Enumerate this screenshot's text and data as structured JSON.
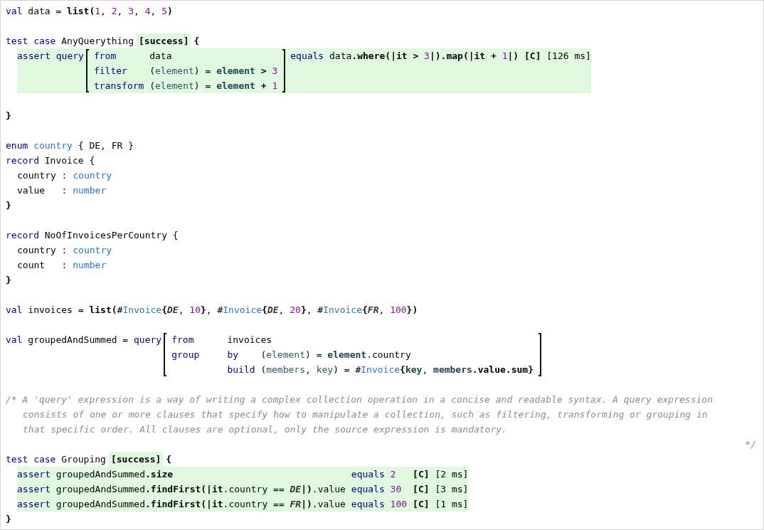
{
  "editor": {
    "blocks": [
      {
        "kind": "code",
        "tokens": [
          {
            "text": "val",
            "kind": "kw"
          },
          {
            "text": " data = ",
            "kind": "plain"
          },
          {
            "text": "list(",
            "kind": "bold"
          },
          {
            "text": "1",
            "kind": "num"
          },
          {
            "text": ", ",
            "kind": "plain"
          },
          {
            "text": "2",
            "kind": "num"
          },
          {
            "text": ", ",
            "kind": "plain"
          },
          {
            "text": "3",
            "kind": "num"
          },
          {
            "text": ", ",
            "kind": "plain"
          },
          {
            "text": "4",
            "kind": "num"
          },
          {
            "text": ", ",
            "kind": "plain"
          },
          {
            "text": "5",
            "kind": "num"
          },
          {
            "text": ")",
            "kind": "bold"
          }
        ]
      },
      {
        "kind": "blank"
      },
      {
        "kind": "test_header",
        "tokens": [
          {
            "text": "test case",
            "kind": "kw"
          },
          {
            "text": " AnyQuerything",
            "kind": "plain"
          }
        ],
        "status": "[success]",
        "passed": true,
        "after": [
          {
            "text": "{",
            "kind": "bold"
          }
        ]
      },
      {
        "kind": "query_assert",
        "passed": true,
        "prefix": [
          {
            "text": "assert query",
            "kind": "kw"
          }
        ],
        "clauses": [
          {
            "keyword": "from",
            "tokens": [
              {
                "text": "data",
                "kind": "plain"
              }
            ]
          },
          {
            "keyword": "filter",
            "tokens": [
              {
                "text": "(",
                "kind": "plain"
              },
              {
                "text": "element",
                "kind": "param"
              },
              {
                "text": ") = ",
                "kind": "plain"
              },
              {
                "text": "element",
                "kind": "paramb"
              },
              {
                "text": " > ",
                "kind": "bold"
              },
              {
                "text": "3",
                "kind": "num"
              }
            ]
          },
          {
            "keyword": "transform",
            "tokens": [
              {
                "text": "(",
                "kind": "plain"
              },
              {
                "text": "element",
                "kind": "param"
              },
              {
                "text": ") = ",
                "kind": "plain"
              },
              {
                "text": "element",
                "kind": "paramb"
              },
              {
                "text": " + ",
                "kind": "bold"
              },
              {
                "text": "1",
                "kind": "num"
              }
            ]
          }
        ],
        "suffix": [
          {
            "text": "equals",
            "kind": "kw"
          },
          {
            "text": " data",
            "kind": "plain"
          },
          {
            "text": ".where(|it > ",
            "kind": "bold"
          },
          {
            "text": "3",
            "kind": "num"
          },
          {
            "text": "|).map(|it + ",
            "kind": "bold"
          },
          {
            "text": "1",
            "kind": "num"
          },
          {
            "text": "|)",
            "kind": "bold"
          },
          {
            "text": " [C]",
            "kind": "bold"
          },
          {
            "text": " [126 ms]",
            "kind": "plain"
          }
        ]
      },
      {
        "kind": "blank"
      },
      {
        "kind": "code",
        "tokens": [
          {
            "text": "}",
            "kind": "bold"
          }
        ]
      },
      {
        "kind": "blank"
      },
      {
        "kind": "code",
        "tokens": [
          {
            "text": "enum",
            "kind": "kw"
          },
          {
            "text": " country",
            "kind": "type"
          },
          {
            "text": " { DE, FR }",
            "kind": "plain"
          }
        ]
      },
      {
        "kind": "code",
        "tokens": [
          {
            "text": "record",
            "kind": "kw"
          },
          {
            "text": " Invoice {",
            "kind": "plain"
          }
        ]
      },
      {
        "kind": "member",
        "tokens": [
          {
            "text": "country : ",
            "kind": "plain"
          },
          {
            "text": "country",
            "kind": "type"
          }
        ]
      },
      {
        "kind": "member",
        "tokens": [
          {
            "text": "value   : ",
            "kind": "plain"
          },
          {
            "text": "number",
            "kind": "type"
          }
        ]
      },
      {
        "kind": "code",
        "tokens": [
          {
            "text": "}",
            "kind": "bold"
          }
        ]
      },
      {
        "kind": "blank"
      },
      {
        "kind": "code",
        "tokens": [
          {
            "text": "record",
            "kind": "kw"
          },
          {
            "text": " NoOfInvoicesPerCountry {",
            "kind": "plain"
          }
        ]
      },
      {
        "kind": "member",
        "tokens": [
          {
            "text": "country : ",
            "kind": "plain"
          },
          {
            "text": "country",
            "kind": "type"
          }
        ]
      },
      {
        "kind": "member",
        "tokens": [
          {
            "text": "count   : ",
            "kind": "plain"
          },
          {
            "text": "number",
            "kind": "type"
          }
        ]
      },
      {
        "kind": "code",
        "tokens": [
          {
            "text": "}",
            "kind": "bold"
          }
        ]
      },
      {
        "kind": "blank"
      },
      {
        "kind": "code",
        "tokens": [
          {
            "text": "val",
            "kind": "kw"
          },
          {
            "text": " invoices = ",
            "kind": "plain"
          },
          {
            "text": "list(",
            "kind": "bold"
          },
          {
            "text": "#",
            "kind": "plain"
          },
          {
            "text": "Invoice",
            "kind": "type"
          },
          {
            "text": "{",
            "kind": "bold"
          },
          {
            "text": "DE",
            "kind": "lit"
          },
          {
            "text": ", ",
            "kind": "plain"
          },
          {
            "text": "10",
            "kind": "num"
          },
          {
            "text": "}",
            "kind": "bold"
          },
          {
            "text": ", #",
            "kind": "plain"
          },
          {
            "text": "Invoice",
            "kind": "type"
          },
          {
            "text": "{",
            "kind": "bold"
          },
          {
            "text": "DE",
            "kind": "lit"
          },
          {
            "text": ", ",
            "kind": "plain"
          },
          {
            "text": "20",
            "kind": "num"
          },
          {
            "text": "}",
            "kind": "bold"
          },
          {
            "text": ", #",
            "kind": "plain"
          },
          {
            "text": "Invoice",
            "kind": "type"
          },
          {
            "text": "{",
            "kind": "bold"
          },
          {
            "text": "FR",
            "kind": "lit"
          },
          {
            "text": ", ",
            "kind": "plain"
          },
          {
            "text": "100",
            "kind": "num"
          },
          {
            "text": "})",
            "kind": "bold"
          }
        ]
      },
      {
        "kind": "blank"
      },
      {
        "kind": "query_val",
        "prefix": [
          {
            "text": "val",
            "kind": "kw"
          },
          {
            "text": " groupedAndSummed = ",
            "kind": "plain"
          },
          {
            "text": "query",
            "kind": "kw"
          }
        ],
        "clauses": [
          {
            "keyword": "from",
            "tokens": [
              {
                "text": "invoices",
                "kind": "plain"
              }
            ]
          },
          {
            "keyword": "group",
            "tokens": [
              {
                "text": "by",
                "kind": "kw"
              },
              {
                "text": "    (",
                "kind": "plain"
              },
              {
                "text": "element",
                "kind": "param"
              },
              {
                "text": ") = ",
                "kind": "plain"
              },
              {
                "text": "element",
                "kind": "paramb"
              },
              {
                "text": ".country",
                "kind": "plain"
              }
            ]
          },
          {
            "tokens": [
              {
                "text": "build",
                "kind": "kw"
              },
              {
                "text": " (",
                "kind": "plain"
              },
              {
                "text": "members",
                "kind": "param"
              },
              {
                "text": ", ",
                "kind": "plain"
              },
              {
                "text": "key",
                "kind": "param"
              },
              {
                "text": ") = #",
                "kind": "plain"
              },
              {
                "text": "Invoice",
                "kind": "type"
              },
              {
                "text": "{",
                "kind": "bold"
              },
              {
                "text": "key",
                "kind": "paramb"
              },
              {
                "text": ", ",
                "kind": "plain"
              },
              {
                "text": "members",
                "kind": "paramb"
              },
              {
                "text": ".value.sum}",
                "kind": "bold"
              }
            ]
          }
        ]
      },
      {
        "kind": "blank"
      },
      {
        "kind": "comment",
        "lines": [
          "/* A 'query' expression is a way of writing a complex collection operation in a concise and readable syntax. A query expression",
          "consists of one or more clauses that specify how to manipulate a collection, such as filtering, transforming or grouping in",
          "that specific order. All clauses are optional, only the source expression is mandatory."
        ],
        "end": "*/"
      },
      {
        "kind": "test_header",
        "tokens": [
          {
            "text": "test case",
            "kind": "kw"
          },
          {
            "text": " Grouping",
            "kind": "plain"
          }
        ],
        "status": "[success]",
        "passed": true,
        "after": [
          {
            "text": "{",
            "kind": "bold"
          }
        ]
      },
      {
        "kind": "assert_group",
        "passed": true,
        "rows": [
          {
            "expr": [
              {
                "text": "assert",
                "kind": "kw"
              },
              {
                "text": " groupedAndSummed",
                "kind": "plain"
              },
              {
                "text": ".size",
                "kind": "bold"
              }
            ],
            "expected": [
              {
                "text": "equals",
                "kind": "kw"
              },
              {
                "text": " 2",
                "kind": "num"
              }
            ],
            "result": [
              {
                "text": "[C]",
                "kind": "bold"
              },
              {
                "text": " [2 ms]",
                "kind": "plain"
              }
            ]
          },
          {
            "expr": [
              {
                "text": "assert",
                "kind": "kw"
              },
              {
                "text": " groupedAndSummed",
                "kind": "plain"
              },
              {
                "text": ".findFirst(|it",
                "kind": "bold"
              },
              {
                "text": ".country == ",
                "kind": "plain"
              },
              {
                "text": "DE",
                "kind": "lit"
              },
              {
                "text": "|)",
                "kind": "bold"
              },
              {
                "text": ".value",
                "kind": "plain"
              }
            ],
            "expected": [
              {
                "text": "equals",
                "kind": "kw"
              },
              {
                "text": " 30",
                "kind": "num"
              }
            ],
            "result": [
              {
                "text": "[C]",
                "kind": "bold"
              },
              {
                "text": " [3 ms]",
                "kind": "plain"
              }
            ]
          },
          {
            "expr": [
              {
                "text": "assert",
                "kind": "kw"
              },
              {
                "text": " groupedAndSummed",
                "kind": "plain"
              },
              {
                "text": ".findFirst(|it",
                "kind": "bold"
              },
              {
                "text": ".country == ",
                "kind": "plain"
              },
              {
                "text": "FR",
                "kind": "lit"
              },
              {
                "text": "|)",
                "kind": "bold"
              },
              {
                "text": ".value",
                "kind": "plain"
              }
            ],
            "expected": [
              {
                "text": "equals",
                "kind": "kw"
              },
              {
                "text": " 100",
                "kind": "num"
              }
            ],
            "result": [
              {
                "text": "[C]",
                "kind": "bold"
              },
              {
                "text": " [1 ms]",
                "kind": "plain"
              }
            ]
          }
        ]
      },
      {
        "kind": "code",
        "tokens": [
          {
            "text": "}",
            "kind": "bold"
          }
        ]
      }
    ]
  }
}
